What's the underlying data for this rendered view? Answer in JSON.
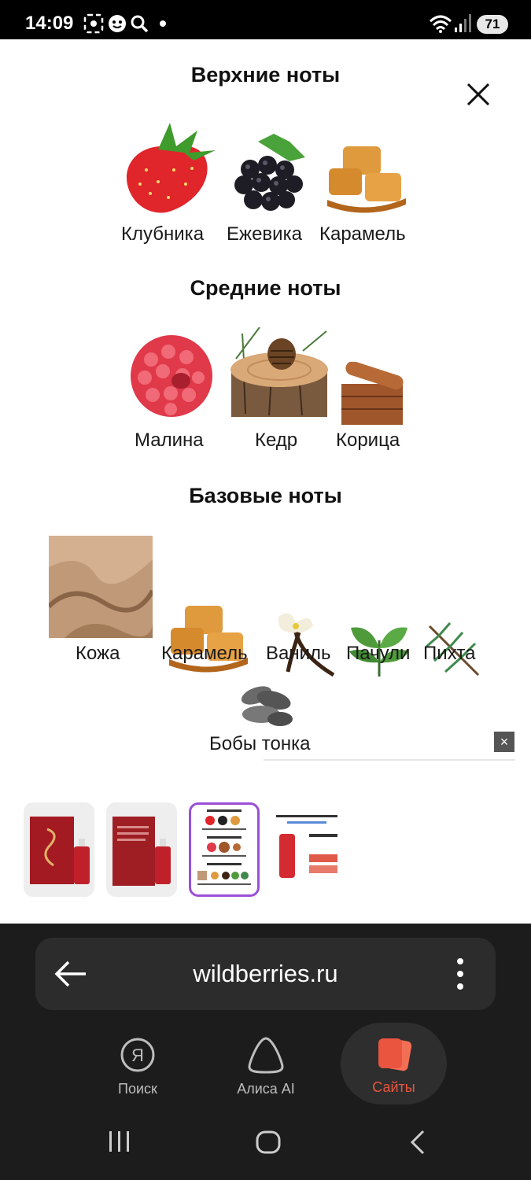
{
  "status_bar": {
    "time": "14:09",
    "battery": "71",
    "icons": [
      "screenshot-icon",
      "face-icon",
      "search-icon",
      "dot-icon",
      "wifi-icon",
      "signal-icon"
    ]
  },
  "notes": {
    "top": {
      "title": "Верхние ноты",
      "items": [
        "Клубника",
        "Ежевика",
        "Карамель"
      ]
    },
    "middle": {
      "title": "Средние ноты",
      "items": [
        "Малина",
        "Кедр",
        "Корица"
      ]
    },
    "base": {
      "title": "Базовые ноты",
      "items": [
        "Кожа",
        "Карамель",
        "Ваниль",
        "Пачули",
        "Пихта",
        "Бобы тонка"
      ]
    }
  },
  "thumbnails": [
    {
      "name": "product-box-front",
      "selected": false
    },
    {
      "name": "product-box-back",
      "selected": false
    },
    {
      "name": "notes-chart",
      "selected": true
    },
    {
      "name": "product-info",
      "selected": false
    }
  ],
  "browser": {
    "url": "wildberries.ru",
    "nav": [
      {
        "label": "Поиск",
        "icon": "yandex-search-icon",
        "active": false
      },
      {
        "label": "Алиса AI",
        "icon": "alice-icon",
        "active": false
      },
      {
        "label": "Сайты",
        "icon": "sites-icon",
        "active": true
      }
    ]
  },
  "colors": {
    "accent": "#e9553f",
    "selected_border": "#9b4fd8"
  }
}
